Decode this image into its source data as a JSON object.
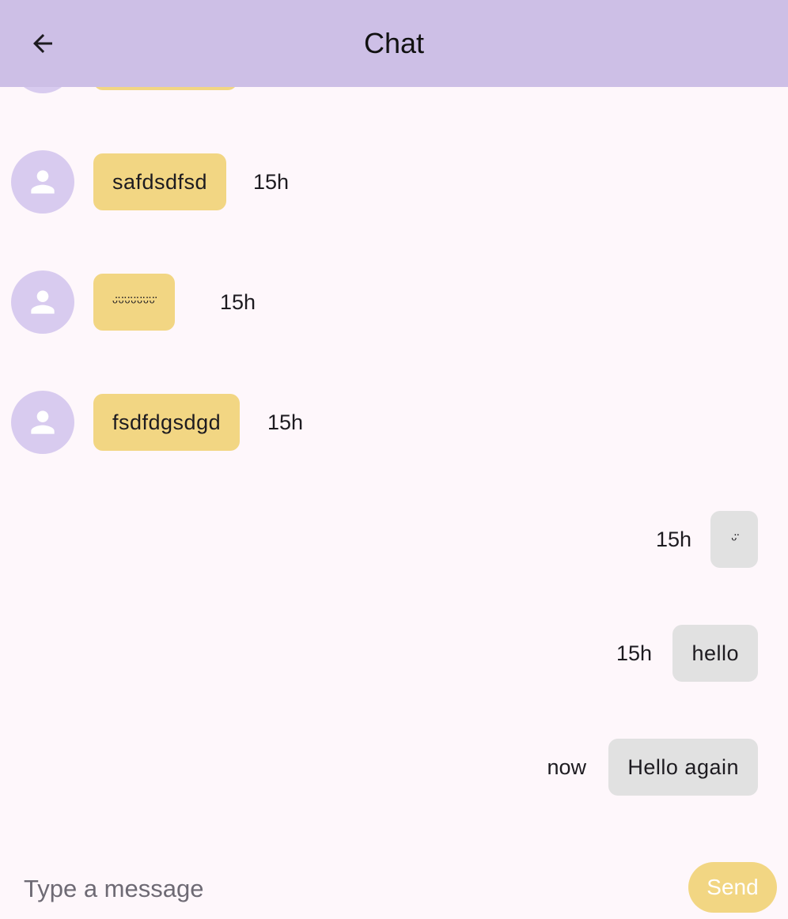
{
  "appbar": {
    "title": "Chat",
    "back_icon": "arrow-left-icon"
  },
  "colors": {
    "appbar": "#cdbfe6",
    "incoming_bubble": "#f2d683",
    "outgoing_bubble": "#e1e1e1",
    "avatar": "#d8cbef",
    "send_button": "#f2d683",
    "background": "#fef7fb"
  },
  "messages": [
    {
      "direction": "incoming",
      "text": "safdsdfsd",
      "time": "15h",
      "avatar_icon": "person-icon"
    },
    {
      "direction": "incoming",
      "text": "ᵕ̈ᵕ̈ᵕ̈ᵕ̈ᵕ̈ᵕ̈ᵕ̈",
      "time": "15h",
      "avatar_icon": "person-icon"
    },
    {
      "direction": "incoming",
      "text": "fsdfdgsdgd",
      "time": "15h",
      "avatar_icon": "person-icon"
    },
    {
      "direction": "outgoing",
      "text": "ᵕ̈",
      "time": "15h"
    },
    {
      "direction": "outgoing",
      "text": "hello",
      "time": "15h"
    },
    {
      "direction": "outgoing",
      "text": "Hello again",
      "time": "now"
    }
  ],
  "composer": {
    "placeholder": "Type a message",
    "value": "",
    "send_label": "Send"
  }
}
